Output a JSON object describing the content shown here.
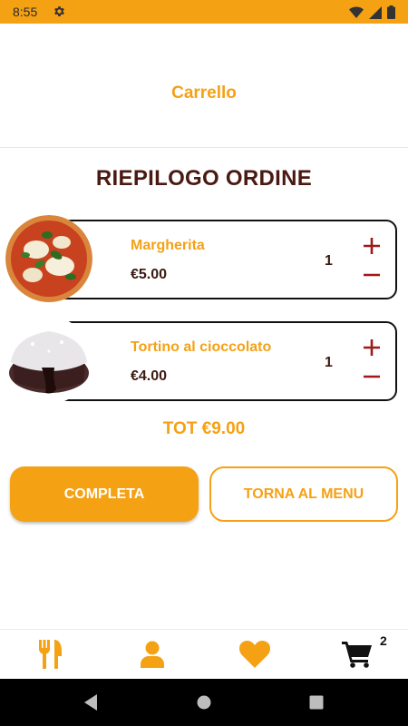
{
  "status_bar": {
    "time": "8:55"
  },
  "header": {
    "title": "Carrello"
  },
  "summary": {
    "title": "RIEPILOGO ORDINE"
  },
  "items": [
    {
      "name": "Margherita",
      "price": "€5.00",
      "quantity": "1",
      "image": "pizza-margherita"
    },
    {
      "name": "Tortino al cioccolato",
      "price": "€4.00",
      "quantity": "1",
      "image": "chocolate-lava-cake"
    }
  ],
  "total": "TOT €9.00",
  "buttons": {
    "complete": "COMPLETA",
    "back_to_menu": "TORNA AL MENU"
  },
  "bottom_nav": {
    "items": [
      {
        "icon": "cutlery-icon"
      },
      {
        "icon": "user-icon"
      },
      {
        "icon": "heart-icon"
      },
      {
        "icon": "cart-icon",
        "badge": "2"
      }
    ]
  },
  "colors": {
    "accent": "#f5a114",
    "dark_text": "#4a1a12",
    "qty_buttons": "#a01818"
  }
}
